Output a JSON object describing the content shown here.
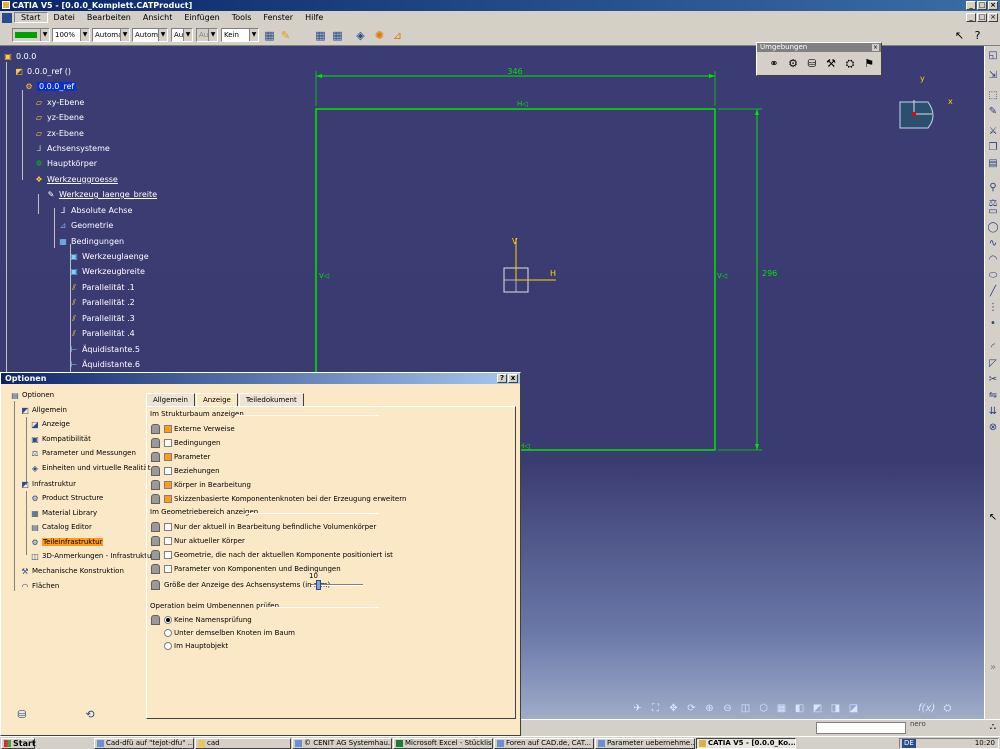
{
  "window": {
    "title": "CATIA V5 - [0.0.0_Komplett.CATProduct]"
  },
  "menu": {
    "items": [
      "Start",
      "Datei",
      "Bearbeiten",
      "Ansicht",
      "Einfügen",
      "Tools",
      "Fenster",
      "Hilfe"
    ]
  },
  "toolbar": {
    "zoom": "100%",
    "combo1": "Automa",
    "combo2": "Automa",
    "combo3": "Aut",
    "combo4": "Aut",
    "combo5": "Kein"
  },
  "tree": {
    "nodes": [
      {
        "label": "0.0.0",
        "style": "plain"
      },
      {
        "label": "0.0.0_ref ()",
        "style": "plain"
      },
      {
        "label": "0.0.0_ref",
        "style": "selected"
      },
      {
        "label": "xy-Ebene",
        "style": "plain"
      },
      {
        "label": "yz-Ebene",
        "style": "plain"
      },
      {
        "label": "zx-Ebene",
        "style": "plain"
      },
      {
        "label": "Achsensysteme",
        "style": "plain"
      },
      {
        "label": "Hauptkörper",
        "style": "plain"
      },
      {
        "label": "Werkzeuggroesse",
        "style": "underline"
      },
      {
        "label": "Werkzeug_laenge_breite",
        "style": "underline"
      },
      {
        "label": "Absolute Achse",
        "style": "plain"
      },
      {
        "label": "Geometrie",
        "style": "plain"
      },
      {
        "label": "Bedingungen",
        "style": "plain"
      },
      {
        "label": "Werkzeuglaenge",
        "style": "plain"
      },
      {
        "label": "Werkzeugbreite",
        "style": "plain"
      },
      {
        "label": "Parallelität .1",
        "style": "plain"
      },
      {
        "label": "Parallelität .2",
        "style": "plain"
      },
      {
        "label": "Parallelität .3",
        "style": "plain"
      },
      {
        "label": "Parallelität .4",
        "style": "plain"
      },
      {
        "label": "Äquidistante.5",
        "style": "plain"
      },
      {
        "label": "Äquidistante.6",
        "style": "plain"
      }
    ]
  },
  "sketch": {
    "dim_width": "346",
    "dim_height": "296",
    "axis_h": "H",
    "axis_v": "V",
    "constraint_h": "H",
    "constraint_v": "V"
  },
  "compass": {
    "x_label": "x",
    "y_label": "y"
  },
  "umgebungen": {
    "title": "Umgebungen"
  },
  "dialog": {
    "title": "Optionen",
    "help_btn": "?",
    "close_btn": "x",
    "tree": [
      {
        "label": "Optionen",
        "icon": "options-icon"
      },
      {
        "label": "Allgemein",
        "icon": "general-icon"
      },
      {
        "label": "Anzeige",
        "icon": "display-icon"
      },
      {
        "label": "Kompatibilität",
        "icon": "compat-icon"
      },
      {
        "label": "Parameter und Messungen",
        "icon": "params-icon"
      },
      {
        "label": "Einheiten und virtuelle Realität",
        "icon": "units-icon"
      },
      {
        "label": "Infrastruktur",
        "icon": "infra-icon"
      },
      {
        "label": "Product Structure",
        "icon": "product-icon"
      },
      {
        "label": "Material Library",
        "icon": "material-icon"
      },
      {
        "label": "Catalog Editor",
        "icon": "catalog-icon"
      },
      {
        "label": "Teileinfrastruktur",
        "icon": "part-infra-icon"
      },
      {
        "label": "3D-Anmerkungen - Infrastruktur",
        "icon": "annotation-icon"
      },
      {
        "label": "Mechanische Konstruktion",
        "icon": "mech-icon"
      },
      {
        "label": "Flächen",
        "icon": "surface-icon"
      }
    ],
    "tabs": [
      "Allgemein",
      "Anzeige",
      "Teiledokument"
    ],
    "active_tab": "Anzeige",
    "group1": {
      "title": "Im Strukturbaum anzeigen",
      "items": [
        {
          "label": "Externe Verweise",
          "checked": true
        },
        {
          "label": "Bedingungen",
          "checked": false
        },
        {
          "label": "Parameter",
          "checked": true
        },
        {
          "label": "Beziehungen",
          "checked": false
        },
        {
          "label": "Körper in Bearbeitung",
          "checked": true
        },
        {
          "label": "Skizzenbasierte Komponentenknoten bei der Erzeugung erweitern",
          "checked": true
        }
      ]
    },
    "group2": {
      "title": "Im Geometriebereich anzeigen",
      "items": [
        {
          "label": "Nur der aktuell in Bearbeitung befindliche Volumenkörper",
          "checked": false
        },
        {
          "label": "Nur aktueller Körper",
          "checked": false
        },
        {
          "label": "Geometrie, die nach der aktuellen Komponente positioniert ist",
          "checked": false
        },
        {
          "label": "Parameter von Komponenten und Bedingungen",
          "checked": false
        }
      ],
      "slider_label": "Größe der Anzeige des Achsensystems (in mm)",
      "slider_value": "10",
      "slider_fraction": 0.1
    },
    "group3": {
      "title": "Operation beim Umbenennen prüfen",
      "options": [
        {
          "label": "Keine Namensprüfung",
          "selected": true
        },
        {
          "label": "Unter demselben Knoten im Baum",
          "selected": false
        },
        {
          "label": "Im Hauptobjekt",
          "selected": false
        }
      ]
    }
  },
  "taskbar": {
    "start": "Start",
    "tasks": [
      {
        "label": "Cad-dfü auf \"tejot-dfu\" ...",
        "active": false
      },
      {
        "label": "cad",
        "active": false
      },
      {
        "label": "© CENIT AG Systemhau...",
        "active": false
      },
      {
        "label": "Microsoft Excel - Stücklis...",
        "active": false
      },
      {
        "label": "Foren auf CAD.de, CAT...",
        "active": false
      },
      {
        "label": "Parameter uebernehme...",
        "active": false
      },
      {
        "label": "CATIA V5 - [0.0.0_Ko...",
        "active": true
      }
    ],
    "lang": "DE",
    "clock": "10:20"
  },
  "colors": {
    "viewport_bg": "#36386a",
    "sketch_green": "#00ff00",
    "dialog_bg": "#fbe8c7",
    "selection_orange": "#ff9a1a",
    "tree_selection": "#0a2fd0"
  }
}
